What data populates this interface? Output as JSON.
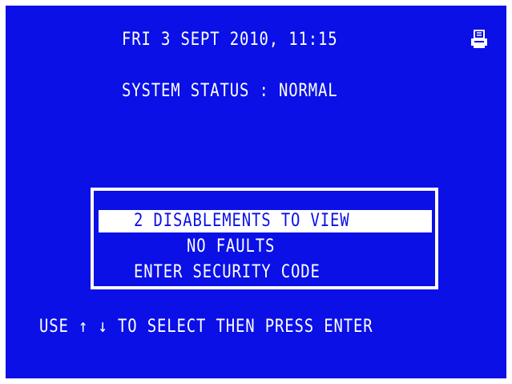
{
  "header": {
    "datetime": "FRI 3 SEPT 2010, 11:15",
    "printer_icon": "printer-icon"
  },
  "status": {
    "text": "SYSTEM STATUS : NORMAL"
  },
  "menu": {
    "items": [
      {
        "label": "2 DISABLEMENTS TO VIEW",
        "selected": true
      },
      {
        "label": "NO FAULTS",
        "selected": false
      },
      {
        "label": "ENTER SECURITY CODE",
        "selected": false
      }
    ]
  },
  "footer": {
    "instruction": "USE ↑ ↓ TO SELECT THEN PRESS ENTER"
  },
  "colors": {
    "screen_background": "#0a10e6",
    "text": "#ffffff",
    "highlight": "#ffffff",
    "highlight_text": "#0a10e6"
  }
}
